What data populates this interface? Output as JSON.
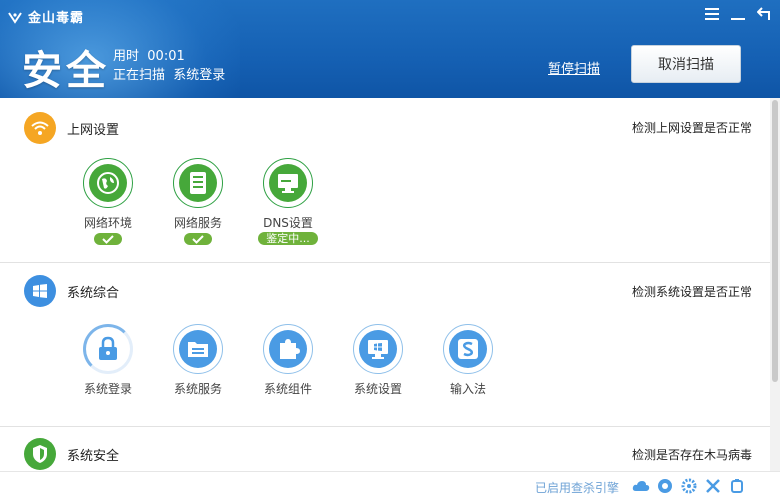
{
  "app": {
    "name": "金山毒霸"
  },
  "header": {
    "state": "安全",
    "time_label": "用时",
    "time_value": "00:01",
    "status_prefix": "正在扫描",
    "status_target": "系统登录",
    "pause_label": "暂停扫描",
    "cancel_label": "取消扫描"
  },
  "sections": [
    {
      "title": "上网设置",
      "desc": "检测上网设置是否正常",
      "items": [
        {
          "label": "网络环境",
          "status": "ok"
        },
        {
          "label": "网络服务",
          "status": "ok"
        },
        {
          "label": "DNS设置",
          "status": "checking",
          "status_text": "鉴定中..."
        }
      ]
    },
    {
      "title": "系统综合",
      "desc": "检测系统设置是否正常",
      "items": [
        {
          "label": "系统登录"
        },
        {
          "label": "系统服务"
        },
        {
          "label": "系统组件"
        },
        {
          "label": "系统设置"
        },
        {
          "label": "输入法"
        }
      ]
    },
    {
      "title": "系统安全",
      "desc": "检测是否存在木马病毒"
    }
  ],
  "footer": {
    "engine_text": "已启用查杀引擎"
  },
  "colors": {
    "header_blue": "#1560b3",
    "ok_green": "#6fb23b",
    "wifi_orange": "#f5a623",
    "win_blue": "#3d8fe0",
    "shield_green": "#46a83a"
  }
}
